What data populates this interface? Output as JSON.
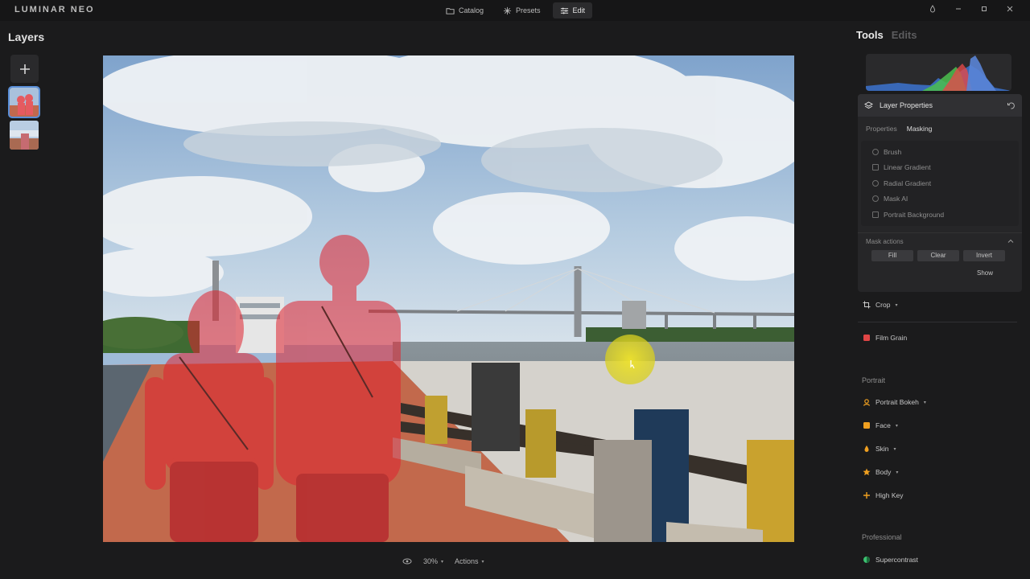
{
  "app": {
    "logo": "LUMINAR NEO"
  },
  "nav": [
    {
      "label": "Catalog",
      "icon": "folder-icon"
    },
    {
      "label": "Presets",
      "icon": "sparkle-icon"
    },
    {
      "label": "Edit",
      "icon": "sliders-icon",
      "active": true
    }
  ],
  "layers": {
    "title": "Layers"
  },
  "right_tabs": {
    "tools": "Tools",
    "edits": "Edits"
  },
  "layer_properties": {
    "title": "Layer Properties",
    "subtabs": [
      "Properties",
      "Masking"
    ],
    "active_subtab": "Masking",
    "mask_tools": [
      "Brush",
      "Linear Gradient",
      "Radial Gradient",
      "Mask AI",
      "Portrait Background"
    ],
    "mask_actions_title": "Mask actions",
    "actions": [
      "Fill",
      "Clear",
      "Invert"
    ],
    "show": "Show"
  },
  "tools": {
    "crop": "Crop",
    "film_grain": "Film Grain",
    "portrait_section": "Portrait",
    "portrait_items": [
      "Portrait Bokeh",
      "Face",
      "Skin",
      "Body",
      "High Key"
    ],
    "professional_section": "Professional",
    "supercontrast": "Supercontrast"
  },
  "bottom": {
    "zoom": "30%",
    "actions": "Actions"
  },
  "colors": {
    "accent_selected": "#5a8fd8",
    "mask_overlay": "#e0232f",
    "cursor_highlight": "#e6dc1e",
    "film_grain_icon": "#e04545",
    "portrait_icon": "#f0a020",
    "supercontrast_icon": "#3cc070"
  }
}
